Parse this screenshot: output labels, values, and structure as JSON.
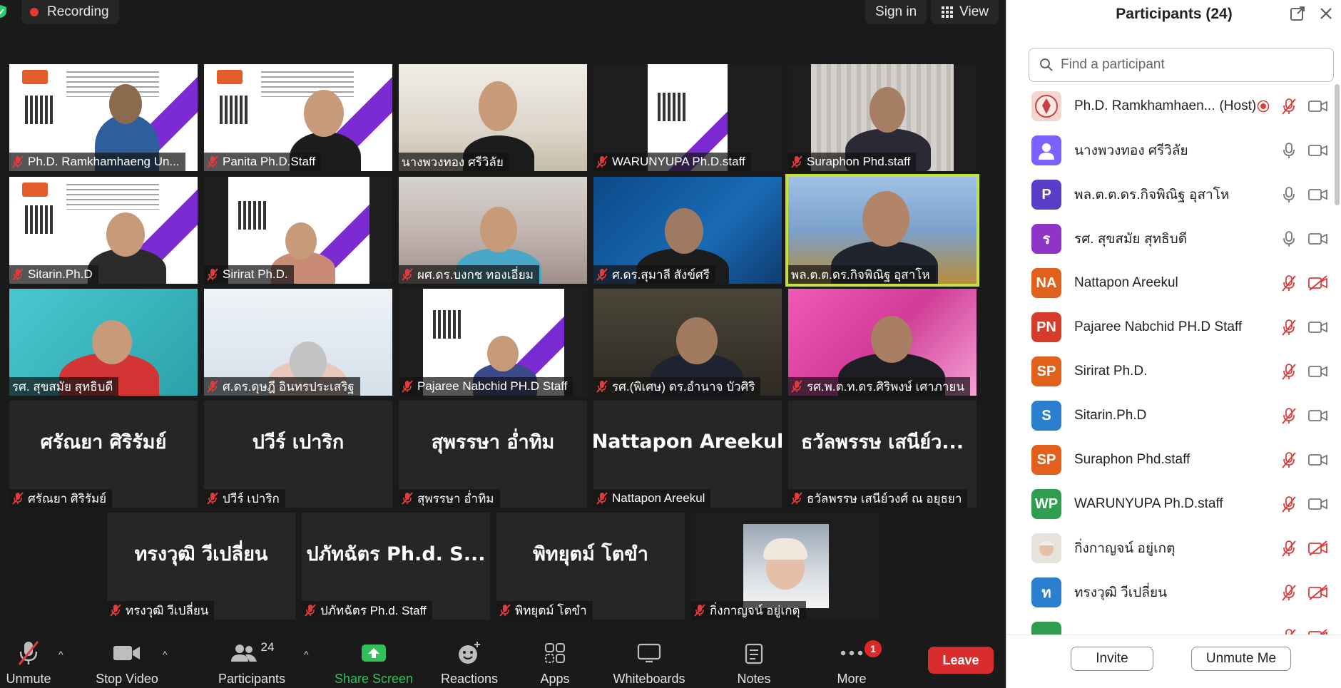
{
  "top_bar": {
    "recording_label": "Recording",
    "sign_in_label": "Sign in",
    "view_label": "View"
  },
  "tiles": [
    {
      "name": "Ph.D. Ramkhamhaeng Un...",
      "muted": true,
      "video": true
    },
    {
      "name": "Panita Ph.D.Staff",
      "muted": true,
      "video": true
    },
    {
      "name": "นางพวงทอง ศรีวิลัย",
      "muted": false,
      "video": true
    },
    {
      "name": "WARUNYUPA Ph.D.staff",
      "muted": true,
      "video": true
    },
    {
      "name": "Suraphon Phd.staff",
      "muted": true,
      "video": true
    },
    {
      "name": "Sitarin.Ph.D",
      "muted": true,
      "video": true
    },
    {
      "name": "Sirirat Ph.D.",
      "muted": true,
      "video": true
    },
    {
      "name": "ผศ.ดร.บงกช ทองเอี่ยม",
      "muted": true,
      "video": true
    },
    {
      "name": "ศ.ดร.สุมาลี สังข์ศรี",
      "muted": true,
      "video": true
    },
    {
      "name": "พล.ต.ต.ดร.กิจพิณิฐ อุสาโห",
      "muted": false,
      "video": true
    },
    {
      "name": "รศ. สุขสมัย สุทธิบดี",
      "muted": false,
      "video": true
    },
    {
      "name": "ศ.ดร.ดุษฎี อินทรประเสริฐ",
      "muted": true,
      "video": true
    },
    {
      "name": "Pajaree Nabchid PH.D Staff",
      "muted": true,
      "video": true
    },
    {
      "name": "รศ.(พิเศษ) ดร.อำนาจ บัวศิริ",
      "muted": true,
      "video": true
    },
    {
      "name": "รศ.พ.ต.ท.ดร.ศิริพงษ์ เศาภายน",
      "muted": true,
      "video": true
    },
    {
      "name": "ศรัณยา ศิริรัมย์",
      "display": "ศรัณยา ศิริรัมย์",
      "muted": true,
      "video": false
    },
    {
      "name": "ปวีร์ เปาริก",
      "display": "ปวีร์  เปาริก",
      "muted": true,
      "video": false
    },
    {
      "name": "สุพรรษา อ่ำทิม",
      "display": "สุพรรษา อ่ำทิม",
      "muted": true,
      "video": false
    },
    {
      "name": "Nattapon Areekul",
      "display": "Nattapon Areekul",
      "muted": true,
      "video": false
    },
    {
      "name": "ธวัลพรรษ เสนีย์วงศ์ ณ อยุธยา",
      "display": "ธวัลพรรษ เสนีย์ว...",
      "muted": true,
      "video": false
    },
    {
      "name": "ทรงวุฒิ วีเปลี่ยน",
      "display": "ทรงวุฒิ วีเปลี่ยน",
      "muted": true,
      "video": false
    },
    {
      "name": "ปภัทฉัตร Ph.d. Staff",
      "display": "ปภัทฉัตร Ph.d. S...",
      "muted": true,
      "video": false
    },
    {
      "name": "พิทยุตม์ โตขำ",
      "display": "พิทยุตม์ โตขำ",
      "muted": true,
      "video": false
    },
    {
      "name": "กิ่งกาญจน์ อยู่เกตุ",
      "muted": true,
      "video": true
    }
  ],
  "toolbar": {
    "unmute": "Unmute",
    "stop_video": "Stop Video",
    "participants": "Participants",
    "participants_count": "24",
    "share_screen": "Share Screen",
    "reactions": "Reactions",
    "apps": "Apps",
    "whiteboards": "Whiteboards",
    "notes": "Notes",
    "more": "More",
    "more_badge": "1",
    "leave": "Leave"
  },
  "panel": {
    "title": "Participants (24)",
    "search_placeholder": "Find a participant",
    "invite": "Invite",
    "unmute_me": "Unmute Me",
    "participants": [
      {
        "name": "Ph.D. Ramkhamhaen...",
        "tag": "(Host)",
        "initials": "",
        "color": "#f3d6d0",
        "mic": "off",
        "cam": "on",
        "recording": true
      },
      {
        "name": "นางพวงทอง ศรีวิลัย",
        "tag": "",
        "initials": "",
        "color": "#7b61ff",
        "mic": "on",
        "cam": "on",
        "recording": false
      },
      {
        "name": "พล.ต.ต.ดร.กิจพิณิฐ  อุสาโห",
        "tag": "",
        "initials": "P",
        "color": "#5b3ec8",
        "mic": "on",
        "cam": "on",
        "recording": false
      },
      {
        "name": "รศ. สุขสมัย สุทธิบดี",
        "tag": "",
        "initials": "ร",
        "color": "#8e35c8",
        "mic": "on",
        "cam": "on",
        "recording": false
      },
      {
        "name": "Nattapon Areekul",
        "tag": "",
        "initials": "NA",
        "color": "#e0601c",
        "mic": "off",
        "cam": "off",
        "recording": false
      },
      {
        "name": "Pajaree Nabchid PH.D Staff",
        "tag": "",
        "initials": "PN",
        "color": "#d63c2a",
        "mic": "off",
        "cam": "on",
        "recording": false
      },
      {
        "name": "Sirirat Ph.D.",
        "tag": "",
        "initials": "SP",
        "color": "#e0601c",
        "mic": "off",
        "cam": "on",
        "recording": false
      },
      {
        "name": "Sitarin.Ph.D",
        "tag": "",
        "initials": "S",
        "color": "#2a7fcf",
        "mic": "off",
        "cam": "on",
        "recording": false
      },
      {
        "name": "Suraphon Phd.staff",
        "tag": "",
        "initials": "SP",
        "color": "#e0601c",
        "mic": "off",
        "cam": "on",
        "recording": false
      },
      {
        "name": "WARUNYUPA Ph.D.staff",
        "tag": "",
        "initials": "WP",
        "color": "#2e9e4e",
        "mic": "off",
        "cam": "on",
        "recording": false
      },
      {
        "name": "กิ่งกาญจน์ อยู่เกตุ",
        "tag": "",
        "initials": "",
        "color": "#d9cfc8",
        "mic": "off",
        "cam": "off",
        "recording": false
      },
      {
        "name": "ทรงวุฒิ วีเปลี่ยน",
        "tag": "",
        "initials": "ท",
        "color": "#2a7fcf",
        "mic": "off",
        "cam": "off",
        "recording": false
      },
      {
        "name": "",
        "tag": "",
        "initials": "",
        "color": "#2e9e4e",
        "mic": "off",
        "cam": "off",
        "recording": false
      }
    ]
  },
  "colors": {
    "meeting_bg": "#1a1a1a",
    "tile_bg": "#262626",
    "active_speaker": "#c6e33b",
    "mute_red": "#e23b3b",
    "share_green": "#32c05b",
    "leave_red": "#d92d2d"
  }
}
